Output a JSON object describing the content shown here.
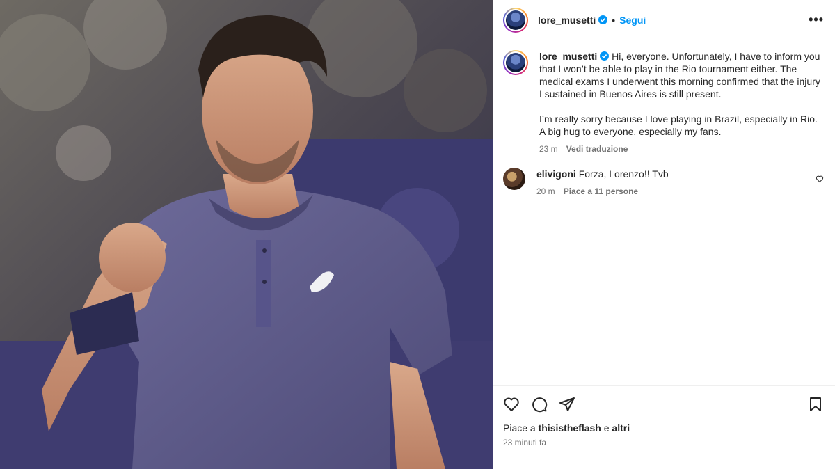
{
  "post": {
    "image_alt_icon": "photo-tennis-player",
    "author": {
      "username": "lore_musetti",
      "verified": true,
      "follow_label": "Segui",
      "separator": "•"
    },
    "more_label": "•••"
  },
  "caption": {
    "username": "lore_musetti",
    "paragraph1": "Hi, everyone. Unfortunately, I have to inform you that I won’t be able to play in the Rio tournament either. The medical exams I underwent this morning confirmed that the injury I sustained in Buenos Aires is still present.",
    "paragraph2": "I’m really sorry because I love playing in Brazil, especially in Rio. A big hug to everyone, especially my fans.",
    "time": "23 m",
    "translate_label": "Vedi traduzione"
  },
  "comments": [
    {
      "username": "elivigoni",
      "text": "Forza, Lorenzo!! Tvb",
      "time": "20 m",
      "likes_label": "Piace a 11 persone"
    }
  ],
  "footer": {
    "likes_prefix": "Piace a ",
    "liked_by": "thisistheflash",
    "likes_mid": " e ",
    "likes_others": "altri",
    "time": "23 minuti fa"
  },
  "colors": {
    "accent": "#0095f6",
    "verified": "#0095f6",
    "shirt": "#5d5a8a"
  }
}
